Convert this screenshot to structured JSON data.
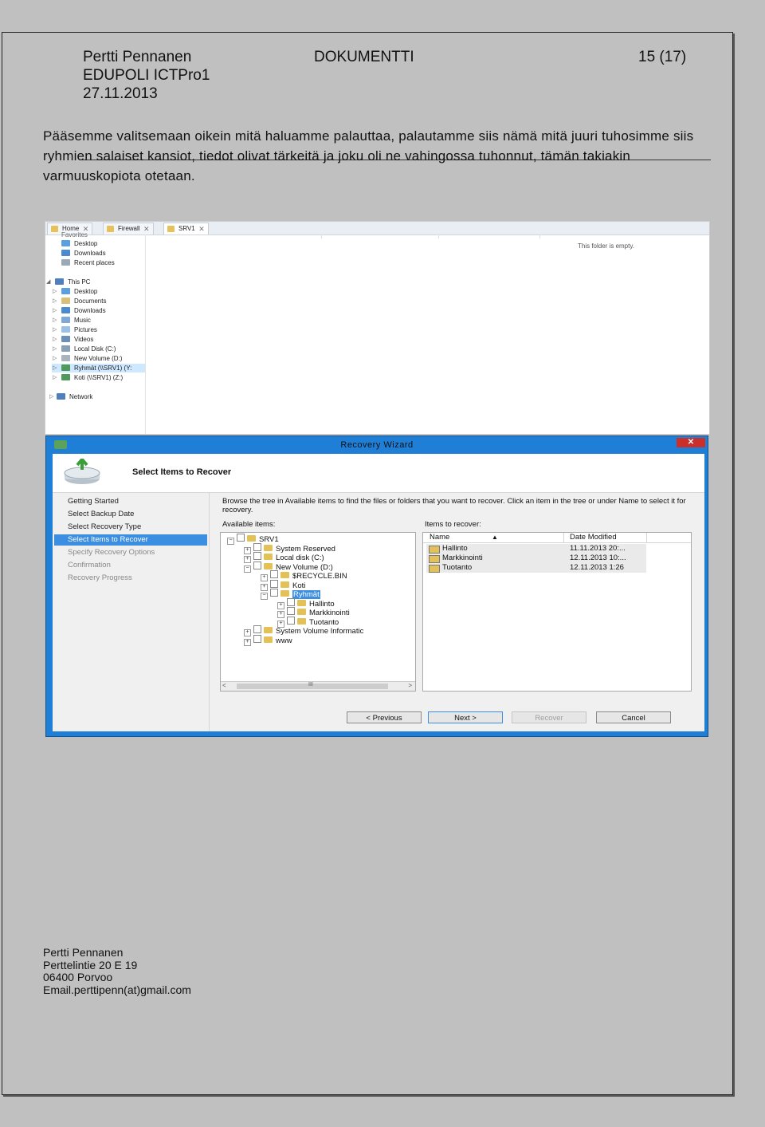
{
  "header": {
    "author": "Pertti Pennanen",
    "course": "EDUPOLI  ICTPro1",
    "date": "27.11.2013",
    "doc_title": "DOKUMENTTI",
    "page": "15 (17)"
  },
  "intro_text": "Pääsemme valitsemaan oikein mitä haluamme palauttaa, palautamme siis nämä mitä juuri tuhosimme siis ryhmien salaiset kansiot, tiedot olivat tärkeitä ja joku oli ne vahingossa tuhonnut, tämän takiakin varmuuskopiota otetaan.",
  "explorer": {
    "tabs": [
      "Home",
      "Firewall",
      "SRV1"
    ],
    "nav_top": [
      "Favorites",
      "Desktop",
      "Downloads",
      "Recent places"
    ],
    "this_pc_label": "This PC",
    "this_pc_items": [
      "Desktop",
      "Documents",
      "Downloads",
      "Music",
      "Pictures",
      "Videos",
      "Local Disk (C:)",
      "New Volume (D:)",
      "Ryhmät (\\\\SRV1) (Y:",
      "Koti (\\\\SRV1) (Z:)"
    ],
    "network_label": "Network",
    "empty_message": "This folder is empty."
  },
  "wizard": {
    "title": "Recovery Wizard",
    "close": "✕",
    "heading": "Select Items to Recover",
    "steps": [
      {
        "label": "Getting Started",
        "state": "done"
      },
      {
        "label": "Select Backup Date",
        "state": "done"
      },
      {
        "label": "Select Recovery Type",
        "state": "done"
      },
      {
        "label": "Select Items to Recover",
        "state": "current"
      },
      {
        "label": "Specify Recovery Options",
        "state": "todo"
      },
      {
        "label": "Confirmation",
        "state": "todo"
      },
      {
        "label": "Recovery Progress",
        "state": "todo"
      }
    ],
    "instruction": "Browse the tree in Available items to find the files or folders that you want to recover. Click an item in the tree or under Name to select it for recovery.",
    "available_label": "Available items:",
    "recover_label": "Items to recover:",
    "tree": [
      {
        "label": "SRV1",
        "level": 0,
        "exp": "−"
      },
      {
        "label": "System Reserved",
        "level": 1,
        "exp": "+"
      },
      {
        "label": "Local disk (C:)",
        "level": 1,
        "exp": "+"
      },
      {
        "label": "New Volume (D:)",
        "level": 1,
        "exp": "−"
      },
      {
        "label": "$RECYCLE.BIN",
        "level": 2,
        "exp": "+"
      },
      {
        "label": "Koti",
        "level": 2,
        "exp": "+"
      },
      {
        "label": "Ryhmät",
        "level": 2,
        "exp": "−",
        "selected": true
      },
      {
        "label": "Hallinto",
        "level": 3,
        "exp": "+"
      },
      {
        "label": "Markkinointi",
        "level": 3,
        "exp": "+"
      },
      {
        "label": "Tuotanto",
        "level": 3,
        "exp": "+"
      },
      {
        "label": "System Volume Informatic",
        "level": 1,
        "exp": "+"
      },
      {
        "label": "www",
        "level": 1,
        "exp": "+"
      }
    ],
    "columns": {
      "name": "Name",
      "date": "Date Modified"
    },
    "items": [
      {
        "name": "Hallinto",
        "date": "11.11.2013 20:..."
      },
      {
        "name": "Markkinointi",
        "date": "12.11.2013 10:..."
      },
      {
        "name": "Tuotanto",
        "date": "12.11.2013 1:26"
      }
    ],
    "scroll_grip": "III",
    "buttons": {
      "previous": "< Previous",
      "next": "Next >",
      "recover": "Recover",
      "cancel": "Cancel"
    }
  },
  "footer": {
    "name": "Pertti Pennanen",
    "street": "Perttelintie 20 E 19",
    "city": "06400 Porvoo",
    "email": "Email.perttipenn(at)gmail.com"
  }
}
